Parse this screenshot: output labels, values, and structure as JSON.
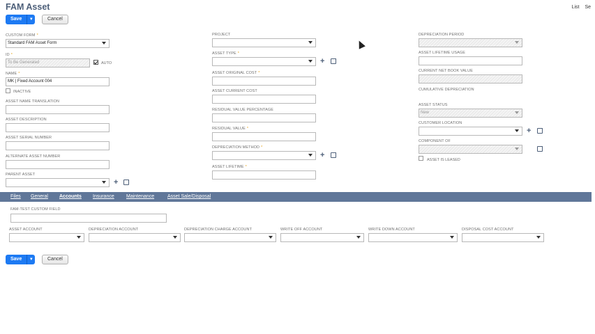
{
  "header": {
    "title": "FAM Asset",
    "links": [
      "List",
      "Se"
    ]
  },
  "buttons": {
    "save_label": "Save",
    "cancel_label": "Cancel"
  },
  "col1": {
    "custom_form": {
      "label": "CUSTOM FORM",
      "value": "Standard FAM Asset Form"
    },
    "id": {
      "label": "ID",
      "value": "To Be Generated",
      "auto_label": "AUTO"
    },
    "name": {
      "label": "NAME",
      "value": "MK | Fixed Account 004"
    },
    "inactive_label": "INACTIVE",
    "asset_name_translation": {
      "label": "ASSET NAME TRANSLATION",
      "value": ""
    },
    "asset_description": {
      "label": "ASSET DESCRIPTION",
      "value": ""
    },
    "asset_serial_number": {
      "label": "ASSET SERIAL NUMBER",
      "value": ""
    },
    "alternate_asset_number": {
      "label": "ALTERNATE ASSET NUMBER",
      "value": ""
    },
    "parent_asset": {
      "label": "PARENT ASSET",
      "value": ""
    }
  },
  "col2": {
    "project": {
      "label": "PROJECT",
      "value": ""
    },
    "asset_type": {
      "label": "ASSET TYPE",
      "value": ""
    },
    "asset_original_cost": {
      "label": "ASSET ORIGINAL COST",
      "value": ""
    },
    "asset_current_cost": {
      "label": "ASSET CURRENT COST",
      "value": ""
    },
    "residual_value_percentage": {
      "label": "RESIDUAL VALUE PERCENTAGE",
      "value": ""
    },
    "residual_value": {
      "label": "RESIDUAL VALUE",
      "value": ""
    },
    "depreciation_method": {
      "label": "DEPRECIATION METHOD",
      "value": ""
    },
    "asset_lifetime": {
      "label": "ASSET LIFETIME",
      "value": ""
    }
  },
  "col3": {
    "depreciation_period": {
      "label": "DEPRECIATION PERIOD",
      "value": ""
    },
    "asset_lifetime_usage": {
      "label": "ASSET LIFETIME USAGE",
      "value": ""
    },
    "current_net_book_value": {
      "label": "CURRENT NET BOOK VALUE",
      "value": ""
    },
    "cumulative_depreciation": {
      "label": "CUMULATIVE DEPRECIATION"
    },
    "asset_status": {
      "label": "ASSET STATUS",
      "value": "New"
    },
    "customer_location": {
      "label": "CUSTOMER LOCATION",
      "value": ""
    },
    "component_of": {
      "label": "COMPONENT OF",
      "value": ""
    },
    "asset_is_leased_label": "ASSET IS LEASED"
  },
  "tabs": [
    "Files",
    "General",
    "Accounts",
    "Insurance",
    "Maintenance",
    "Asset Sale/Disposal"
  ],
  "accounts": {
    "custom_field": {
      "label": "FAM-TEST CUSTOM FIELD",
      "value": ""
    },
    "asset_account": {
      "label": "ASSET ACCOUNT",
      "value": ""
    },
    "depreciation_account": {
      "label": "DEPRECIATION ACCOUNT",
      "value": ""
    },
    "depreciation_charge_account": {
      "label": "DEPRECIATION CHARGE ACCOUNT",
      "value": ""
    },
    "write_off_account": {
      "label": "WRITE OFF ACCOUNT",
      "value": ""
    },
    "write_down_account": {
      "label": "WRITE DOWN ACCOUNT",
      "value": ""
    },
    "disposal_cost_account": {
      "label": "DISPOSAL COST ACCOUNT",
      "value": ""
    }
  },
  "colors": {
    "accent": "#1d7af3",
    "tabbar": "#607799",
    "title": "#4d5f79"
  }
}
